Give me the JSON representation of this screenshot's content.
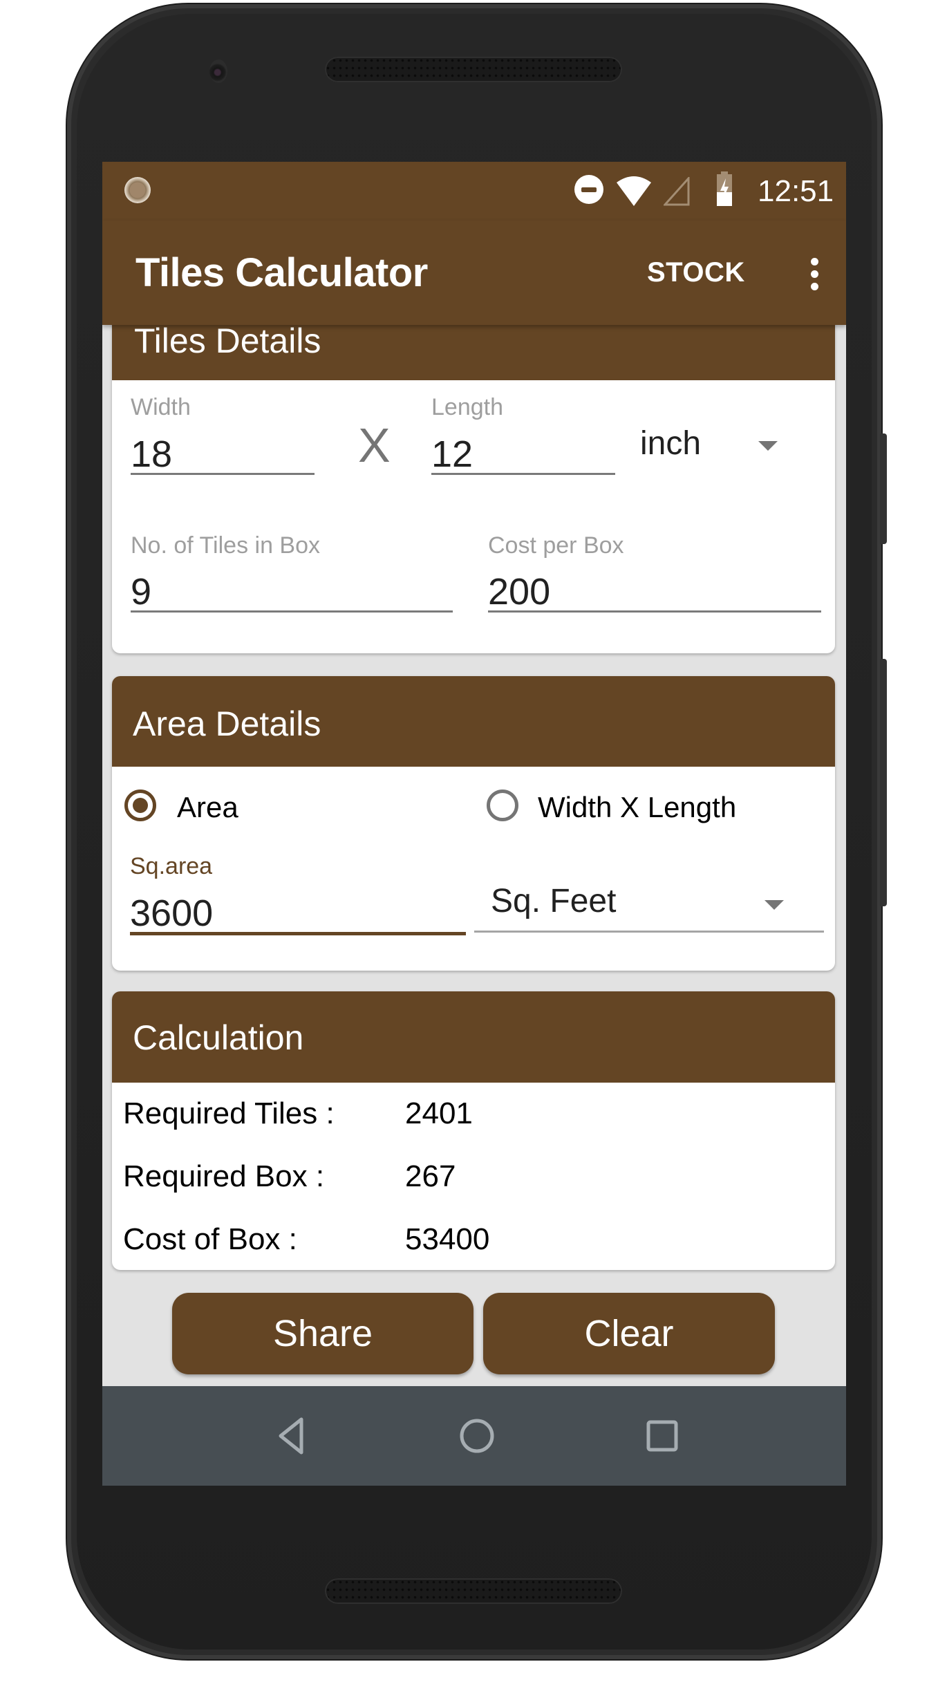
{
  "status_bar": {
    "time": "12:51",
    "icons": [
      "notification-dot-icon",
      "do-not-disturb-icon",
      "wifi-icon",
      "cell-signal-icon",
      "battery-charging-icon"
    ]
  },
  "app_bar": {
    "title": "Tiles Calculator",
    "stock_label": "STOCK",
    "overflow_icon": "more-vert-icon"
  },
  "tiles_details": {
    "header": "Tiles Details",
    "width_label": "Width",
    "width_value": "18",
    "separator": "X",
    "length_label": "Length",
    "length_value": "12",
    "unit_selected": "inch",
    "tiles_in_box_label": "No. of Tiles in Box",
    "tiles_in_box_value": "9",
    "cost_per_box_label": "Cost per Box",
    "cost_per_box_value": "200"
  },
  "area_details": {
    "header": "Area Details",
    "radio_area_label": "Area",
    "radio_area_checked": true,
    "radio_wxl_label": "Width X Length",
    "radio_wxl_checked": false,
    "sq_area_label": "Sq.area",
    "sq_area_value": "3600",
    "area_unit_selected": "Sq. Feet"
  },
  "calculation": {
    "header": "Calculation",
    "rows": [
      {
        "label": "Required Tiles :",
        "value": "2401"
      },
      {
        "label": "Required Box :",
        "value": "267"
      },
      {
        "label": "Cost of Box :",
        "value": "53400"
      }
    ]
  },
  "actions": {
    "share_label": "Share",
    "clear_label": "Clear"
  },
  "nav_bar": {
    "icons": [
      "back-icon",
      "home-icon",
      "recents-icon"
    ]
  },
  "colors": {
    "primary": "#644524",
    "nav_bar": "#474e53",
    "background": "#e2e2e2"
  }
}
